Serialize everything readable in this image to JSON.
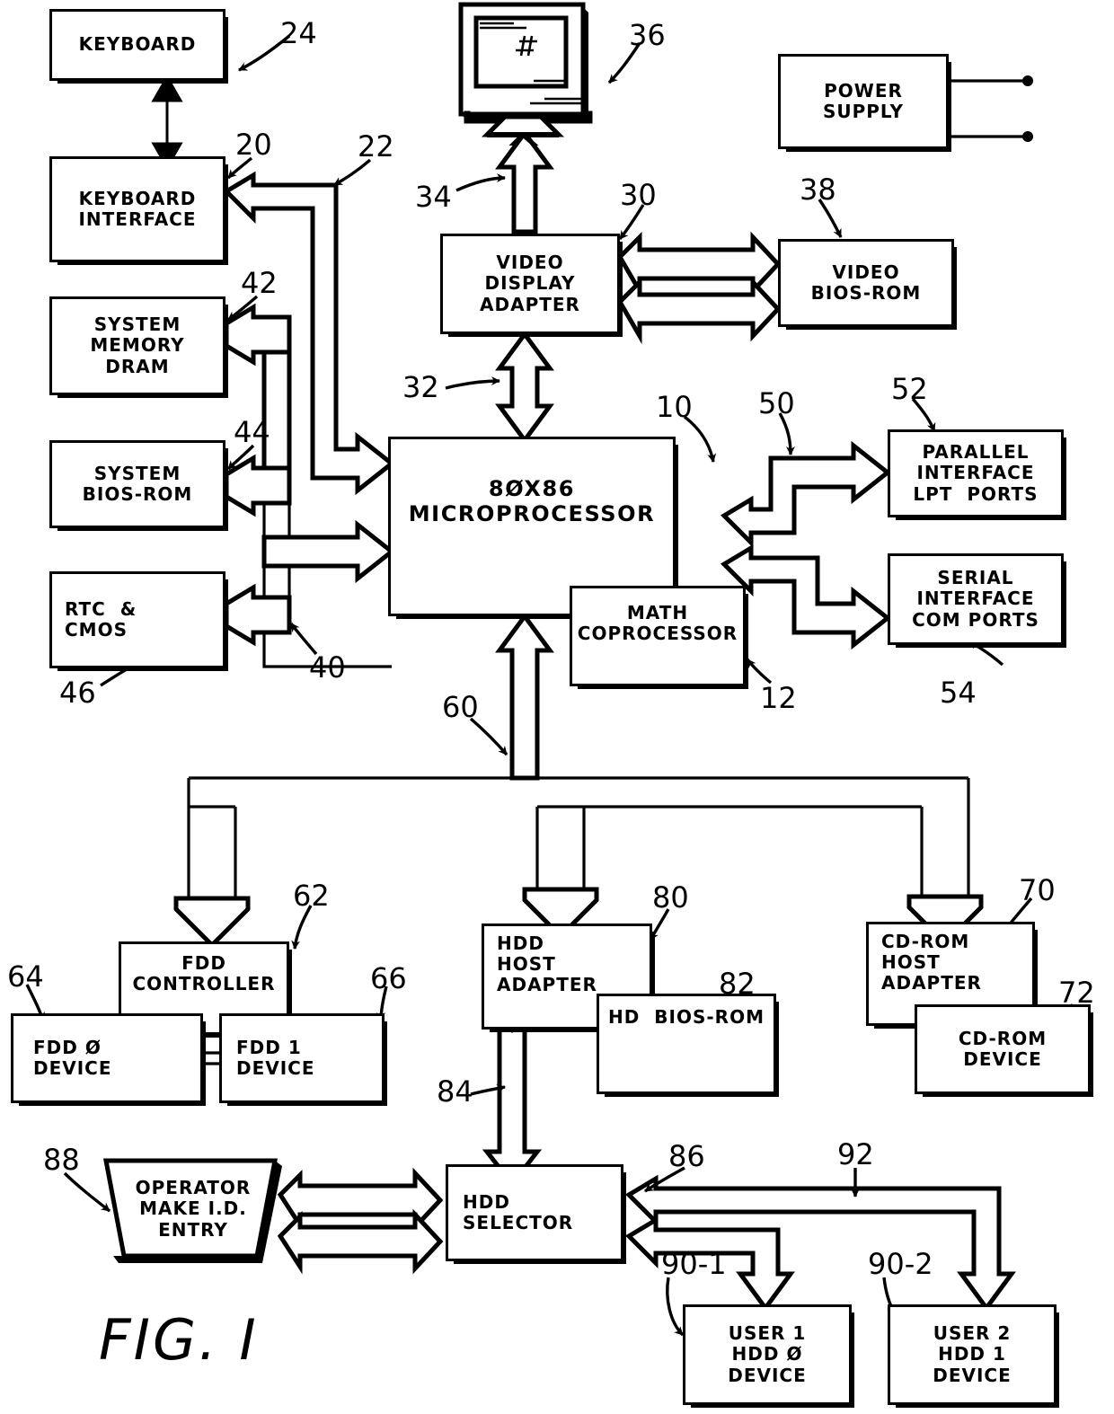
{
  "figure": {
    "caption": "FIG. I",
    "title": "Computer system block diagram"
  },
  "blocks": [
    {
      "id": "keyboard",
      "ref": "24",
      "label": "KEYBOARD"
    },
    {
      "id": "keyboard-interface",
      "ref": "20",
      "label": "KEYBOARD\nINTERFACE"
    },
    {
      "id": "system-memory",
      "ref": "42",
      "label": "SYSTEM\nMEMORY\nDRAM"
    },
    {
      "id": "system-bios-rom",
      "ref": "44",
      "label": "SYSTEM\nBIOS-ROM"
    },
    {
      "id": "rtc-cmos",
      "ref": "46",
      "label": "RTC  &\n  CMOS"
    },
    {
      "id": "video-display-adapter",
      "ref": "30",
      "label": "VIDEO\nDISPLAY\nADAPTER"
    },
    {
      "id": "video-bios-rom",
      "ref": "38",
      "label": "VIDEO\nBIOS-ROM"
    },
    {
      "id": "power-supply",
      "ref": "",
      "label": "POWER\nSUPPLY"
    },
    {
      "id": "microprocessor",
      "ref": "10",
      "label": "8ØX86\nMICROPROCESSOR"
    },
    {
      "id": "math-coprocessor",
      "ref": "12",
      "label": "MATH\nCOPROCESSOR"
    },
    {
      "id": "parallel-interface",
      "ref": "52",
      "label": "PARALLEL\nINTERFACE\nLPT  PORTS"
    },
    {
      "id": "serial-interface",
      "ref": "54",
      "label": "SERIAL\nINTERFACE\nCOM PORTS"
    },
    {
      "id": "fdd-controller",
      "ref": "62",
      "label": "FDD\nCONTROLLER"
    },
    {
      "id": "fdd-0-device",
      "ref": "64",
      "label": "FDD Ø\nDEVICE"
    },
    {
      "id": "fdd-1-device",
      "ref": "66",
      "label": "FDD 1\nDEVICE"
    },
    {
      "id": "hdd-host-adapter",
      "ref": "80",
      "label": "HDD\nHOST\nADAPTER"
    },
    {
      "id": "hd-bios-rom",
      "ref": "82",
      "label": "HD  BIOS-ROM"
    },
    {
      "id": "cdrom-host-adapter",
      "ref": "70",
      "label": "CD-ROM\nHOST\nADAPTER"
    },
    {
      "id": "cdrom-device",
      "ref": "72",
      "label": "CD-ROM\nDEVICE"
    },
    {
      "id": "operator-id-entry",
      "ref": "88",
      "label": "OPERATOR\nMAKE I.D.\nENTRY"
    },
    {
      "id": "hdd-selector",
      "ref": "86",
      "label": "HDD\nSELECTOR"
    },
    {
      "id": "user1-hdd0-device",
      "ref": "90-1",
      "label": "USER 1\nHDD Ø\nDEVICE"
    },
    {
      "id": "user2-hdd1-device",
      "ref": "90-2",
      "label": "USER 2\nHDD 1\nDEVICE"
    },
    {
      "id": "monitor",
      "ref": "36",
      "label": ""
    }
  ],
  "bus_refs": [
    {
      "id": "keyboard-bus",
      "ref": "22"
    },
    {
      "id": "memory-bus",
      "ref": "40"
    },
    {
      "id": "video-bus",
      "ref": "32"
    },
    {
      "id": "monitor-cable",
      "ref": "34"
    },
    {
      "id": "io-bus",
      "ref": "50"
    },
    {
      "id": "expansion-bus",
      "ref": "60"
    },
    {
      "id": "hdd-data-bus",
      "ref": "84"
    },
    {
      "id": "user-select-bus",
      "ref": "92"
    }
  ],
  "labels": {
    "keyboard": "KEYBOARD",
    "keyboard_interface_l1": "KEYBOARD",
    "keyboard_interface_l2": "INTERFACE",
    "system_memory_l1": "SYSTEM",
    "system_memory_l2": "MEMORY",
    "system_memory_l3": "DRAM",
    "system_bios_l1": "SYSTEM",
    "system_bios_l2": "BIOS-ROM",
    "rtc_l1": "RTC  &",
    "rtc_l2": "CMOS",
    "vda_l1": "VIDEO",
    "vda_l2": "DISPLAY",
    "vda_l3": "ADAPTER",
    "vbios_l1": "VIDEO",
    "vbios_l2": "BIOS-ROM",
    "psu_l1": "POWER",
    "psu_l2": "SUPPLY",
    "cpu_l1": "8ØX86",
    "cpu_l2": "MICROPROCESSOR",
    "math_l1": "MATH",
    "math_l2": "COPROCESSOR",
    "par_l1": "PARALLEL",
    "par_l2": "INTERFACE",
    "par_l3": "LPT  PORTS",
    "ser_l1": "SERIAL",
    "ser_l2": "INTERFACE",
    "ser_l3": "COM PORTS",
    "fddc_l1": "FDD",
    "fddc_l2": "CONTROLLER",
    "fdd0_l1": "FDD Ø",
    "fdd0_l2": "DEVICE",
    "fdd1_l1": "FDD 1",
    "fdd1_l2": "DEVICE",
    "hddha_l1": "HDD",
    "hddha_l2": "HOST",
    "hddha_l3": "ADAPTER",
    "hdbios_l1": "HD  BIOS-ROM",
    "cdha_l1": "CD-ROM",
    "cdha_l2": "HOST",
    "cdha_l3": "ADAPTER",
    "cddev_l1": "CD-ROM",
    "cddev_l2": "DEVICE",
    "op_l1": "OPERATOR",
    "op_l2": "MAKE I.D.",
    "op_l3": "ENTRY",
    "hddsel_l1": "HDD",
    "hddsel_l2": "SELECTOR",
    "u1_l1": "USER 1",
    "u1_l2": "HDD Ø",
    "u1_l3": "DEVICE",
    "u2_l1": "USER 2",
    "u2_l2": "HDD 1",
    "u2_l3": "DEVICE"
  },
  "refnums": {
    "n10": "10",
    "n12": "12",
    "n20": "20",
    "n22": "22",
    "n24": "24",
    "n30": "30",
    "n32": "32",
    "n34": "34",
    "n36": "36",
    "n38": "38",
    "n40": "40",
    "n42": "42",
    "n44": "44",
    "n46": "46",
    "n50": "50",
    "n52": "52",
    "n54": "54",
    "n60": "60",
    "n62": "62",
    "n64": "64",
    "n66": "66",
    "n70": "70",
    "n72": "72",
    "n80": "80",
    "n82": "82",
    "n84": "84",
    "n86": "86",
    "n88": "88",
    "n90_1": "90-1",
    "n90_2": "90-2",
    "n92": "92"
  },
  "colors": {
    "ink": "#000000",
    "paper": "#ffffff"
  }
}
